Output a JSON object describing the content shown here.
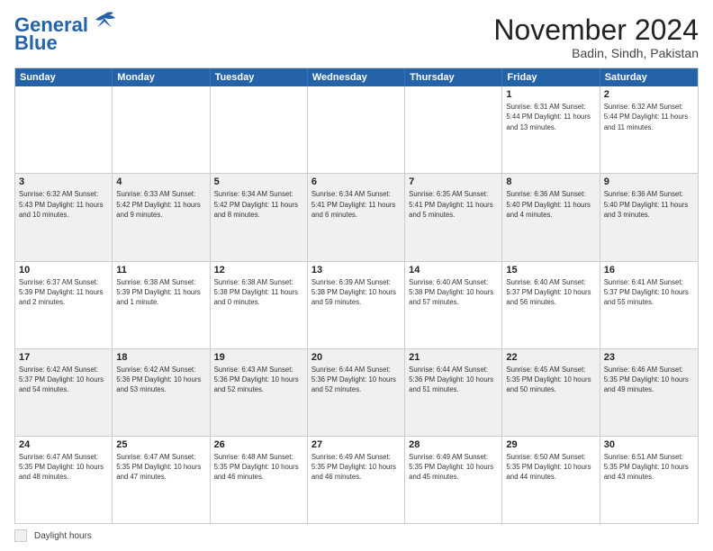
{
  "header": {
    "logo_line1": "General",
    "logo_line2": "Blue",
    "month_title": "November 2024",
    "location": "Badin, Sindh, Pakistan"
  },
  "days_of_week": [
    "Sunday",
    "Monday",
    "Tuesday",
    "Wednesday",
    "Thursday",
    "Friday",
    "Saturday"
  ],
  "weeks": [
    [
      {
        "day": "",
        "info": ""
      },
      {
        "day": "",
        "info": ""
      },
      {
        "day": "",
        "info": ""
      },
      {
        "day": "",
        "info": ""
      },
      {
        "day": "",
        "info": ""
      },
      {
        "day": "1",
        "info": "Sunrise: 6:31 AM\nSunset: 5:44 PM\nDaylight: 11 hours\nand 13 minutes."
      },
      {
        "day": "2",
        "info": "Sunrise: 6:32 AM\nSunset: 5:44 PM\nDaylight: 11 hours\nand 11 minutes."
      }
    ],
    [
      {
        "day": "3",
        "info": "Sunrise: 6:32 AM\nSunset: 5:43 PM\nDaylight: 11 hours\nand 10 minutes."
      },
      {
        "day": "4",
        "info": "Sunrise: 6:33 AM\nSunset: 5:42 PM\nDaylight: 11 hours\nand 9 minutes."
      },
      {
        "day": "5",
        "info": "Sunrise: 6:34 AM\nSunset: 5:42 PM\nDaylight: 11 hours\nand 8 minutes."
      },
      {
        "day": "6",
        "info": "Sunrise: 6:34 AM\nSunset: 5:41 PM\nDaylight: 11 hours\nand 6 minutes."
      },
      {
        "day": "7",
        "info": "Sunrise: 6:35 AM\nSunset: 5:41 PM\nDaylight: 11 hours\nand 5 minutes."
      },
      {
        "day": "8",
        "info": "Sunrise: 6:36 AM\nSunset: 5:40 PM\nDaylight: 11 hours\nand 4 minutes."
      },
      {
        "day": "9",
        "info": "Sunrise: 6:36 AM\nSunset: 5:40 PM\nDaylight: 11 hours\nand 3 minutes."
      }
    ],
    [
      {
        "day": "10",
        "info": "Sunrise: 6:37 AM\nSunset: 5:39 PM\nDaylight: 11 hours\nand 2 minutes."
      },
      {
        "day": "11",
        "info": "Sunrise: 6:38 AM\nSunset: 5:39 PM\nDaylight: 11 hours\nand 1 minute."
      },
      {
        "day": "12",
        "info": "Sunrise: 6:38 AM\nSunset: 5:38 PM\nDaylight: 11 hours\nand 0 minutes."
      },
      {
        "day": "13",
        "info": "Sunrise: 6:39 AM\nSunset: 5:38 PM\nDaylight: 10 hours\nand 59 minutes."
      },
      {
        "day": "14",
        "info": "Sunrise: 6:40 AM\nSunset: 5:38 PM\nDaylight: 10 hours\nand 57 minutes."
      },
      {
        "day": "15",
        "info": "Sunrise: 6:40 AM\nSunset: 5:37 PM\nDaylight: 10 hours\nand 56 minutes."
      },
      {
        "day": "16",
        "info": "Sunrise: 6:41 AM\nSunset: 5:37 PM\nDaylight: 10 hours\nand 55 minutes."
      }
    ],
    [
      {
        "day": "17",
        "info": "Sunrise: 6:42 AM\nSunset: 5:37 PM\nDaylight: 10 hours\nand 54 minutes."
      },
      {
        "day": "18",
        "info": "Sunrise: 6:42 AM\nSunset: 5:36 PM\nDaylight: 10 hours\nand 53 minutes."
      },
      {
        "day": "19",
        "info": "Sunrise: 6:43 AM\nSunset: 5:36 PM\nDaylight: 10 hours\nand 52 minutes."
      },
      {
        "day": "20",
        "info": "Sunrise: 6:44 AM\nSunset: 5:36 PM\nDaylight: 10 hours\nand 52 minutes."
      },
      {
        "day": "21",
        "info": "Sunrise: 6:44 AM\nSunset: 5:36 PM\nDaylight: 10 hours\nand 51 minutes."
      },
      {
        "day": "22",
        "info": "Sunrise: 6:45 AM\nSunset: 5:35 PM\nDaylight: 10 hours\nand 50 minutes."
      },
      {
        "day": "23",
        "info": "Sunrise: 6:46 AM\nSunset: 5:35 PM\nDaylight: 10 hours\nand 49 minutes."
      }
    ],
    [
      {
        "day": "24",
        "info": "Sunrise: 6:47 AM\nSunset: 5:35 PM\nDaylight: 10 hours\nand 48 minutes."
      },
      {
        "day": "25",
        "info": "Sunrise: 6:47 AM\nSunset: 5:35 PM\nDaylight: 10 hours\nand 47 minutes."
      },
      {
        "day": "26",
        "info": "Sunrise: 6:48 AM\nSunset: 5:35 PM\nDaylight: 10 hours\nand 46 minutes."
      },
      {
        "day": "27",
        "info": "Sunrise: 6:49 AM\nSunset: 5:35 PM\nDaylight: 10 hours\nand 46 minutes."
      },
      {
        "day": "28",
        "info": "Sunrise: 6:49 AM\nSunset: 5:35 PM\nDaylight: 10 hours\nand 45 minutes."
      },
      {
        "day": "29",
        "info": "Sunrise: 6:50 AM\nSunset: 5:35 PM\nDaylight: 10 hours\nand 44 minutes."
      },
      {
        "day": "30",
        "info": "Sunrise: 6:51 AM\nSunset: 5:35 PM\nDaylight: 10 hours\nand 43 minutes."
      }
    ]
  ],
  "footer": {
    "legend_label": "Daylight hours"
  }
}
